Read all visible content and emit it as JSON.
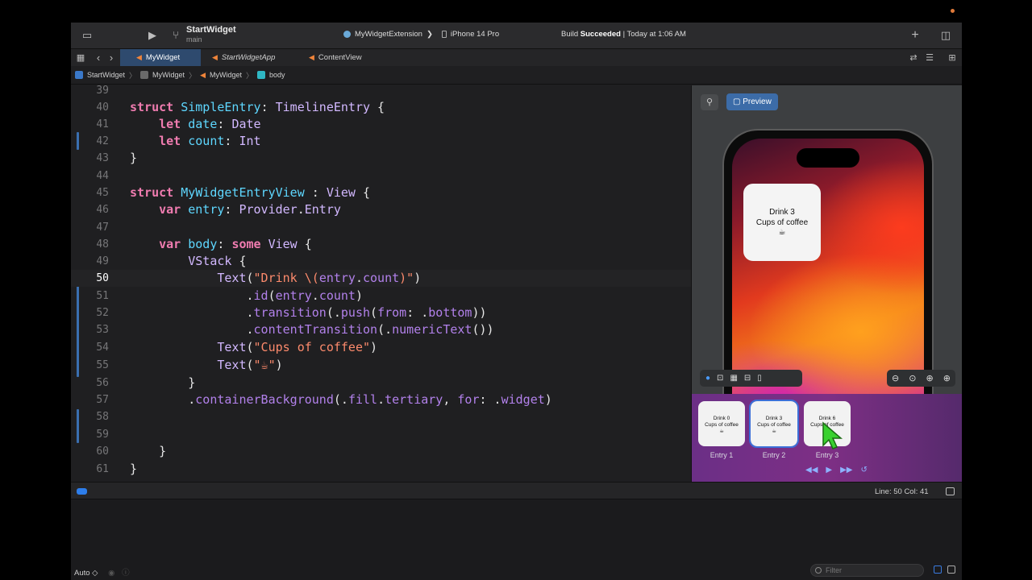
{
  "toolbar": {
    "project_name": "StartWidget",
    "branch": "main",
    "scheme": "MyWidgetExtension",
    "scheme_sep": "❯",
    "device": "iPhone 14 Pro",
    "status_prefix": "Build ",
    "status_bold": "Succeeded",
    "status_suffix": " | Today at 1:06 AM"
  },
  "tabs": [
    {
      "label": "MyWidget",
      "active": true
    },
    {
      "label": "StartWidgetApp",
      "active": false
    },
    {
      "label": "ContentView",
      "active": false
    }
  ],
  "breadcrumb": [
    "StartWidget",
    "MyWidget",
    "MyWidget",
    "body"
  ],
  "breadcrumb_sep": "〉",
  "editor": {
    "current_line": 50,
    "line_numbers": [
      "39",
      "40",
      "41",
      "42",
      "43",
      "44",
      "45",
      "46",
      "47",
      "48",
      "49",
      "50",
      "51",
      "52",
      "53",
      "54",
      "55",
      "56",
      "57",
      "58",
      "59",
      "60",
      "61"
    ]
  },
  "preview": {
    "pin_icon": "pin-icon",
    "button_label": "Preview",
    "widget_line1": "Drink 3",
    "widget_line2": "Cups of coffee",
    "widget_line3": "☕"
  },
  "entries": [
    {
      "label": "Entry 1",
      "line1": "Drink 0",
      "line2": "Cups of coffee",
      "line3": "☕"
    },
    {
      "label": "Entry 2",
      "line1": "Drink 3",
      "line2": "Cups of coffee",
      "line3": "☕"
    },
    {
      "label": "Entry 3",
      "line1": "Drink 6",
      "line2": "Cups of coffee",
      "line3": "☕"
    }
  ],
  "statusbar": {
    "line_col": "Line: 50  Col: 41"
  },
  "console": {
    "auto_label": "Auto ◇",
    "filter_placeholder": "Filter"
  },
  "colors": {
    "accent": "#3c6ca8",
    "keyword": "#f07cb0",
    "type": "#5ed7ff",
    "string": "#fc8a6c"
  }
}
